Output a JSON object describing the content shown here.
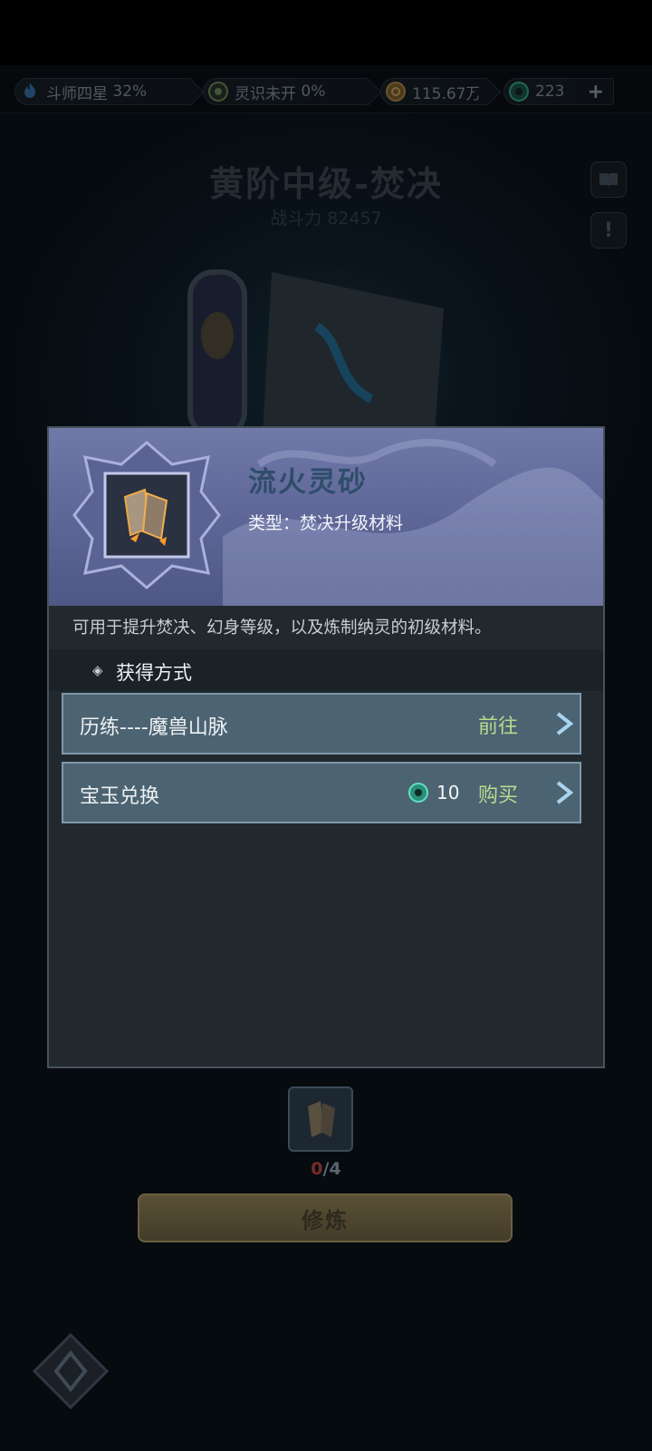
{
  "resources": {
    "rank": {
      "label": "斗师四星",
      "value": "32%",
      "icon": "flame-icon"
    },
    "spirit": {
      "label": "灵识未开",
      "value": "0%",
      "icon": "spirit-swirl-icon"
    },
    "gold": {
      "value": "115.67万",
      "icon": "coin-icon"
    },
    "jade": {
      "value": "223",
      "icon": "jade-icon",
      "plus": "+"
    }
  },
  "skill": {
    "title": "黄阶中级-焚决",
    "power_label": "战斗力",
    "power_value": "82457"
  },
  "side_buttons": {
    "book_icon": "book-icon",
    "info_label": "!"
  },
  "item_popup": {
    "name": "流火灵砂",
    "type_label": "类型：",
    "type_value": "焚决升级材料",
    "description": "可用于提升焚决、幻身等级，以及炼制纳灵的初级材料。",
    "methods_label": "获得方式",
    "methods": [
      {
        "name": "历练----魔兽山脉",
        "action": "前往"
      },
      {
        "name": "宝玉兑换",
        "cost": "10",
        "cost_icon": "jade-icon",
        "action": "购买"
      }
    ]
  },
  "material": {
    "current": "0",
    "required": "/4"
  },
  "train_button": "修炼",
  "colors": {
    "accent_green": "#b6dc8e",
    "popup_header": "#6a73a3",
    "row_bg": "#4c6372",
    "count_red": "#7a2a2a"
  }
}
